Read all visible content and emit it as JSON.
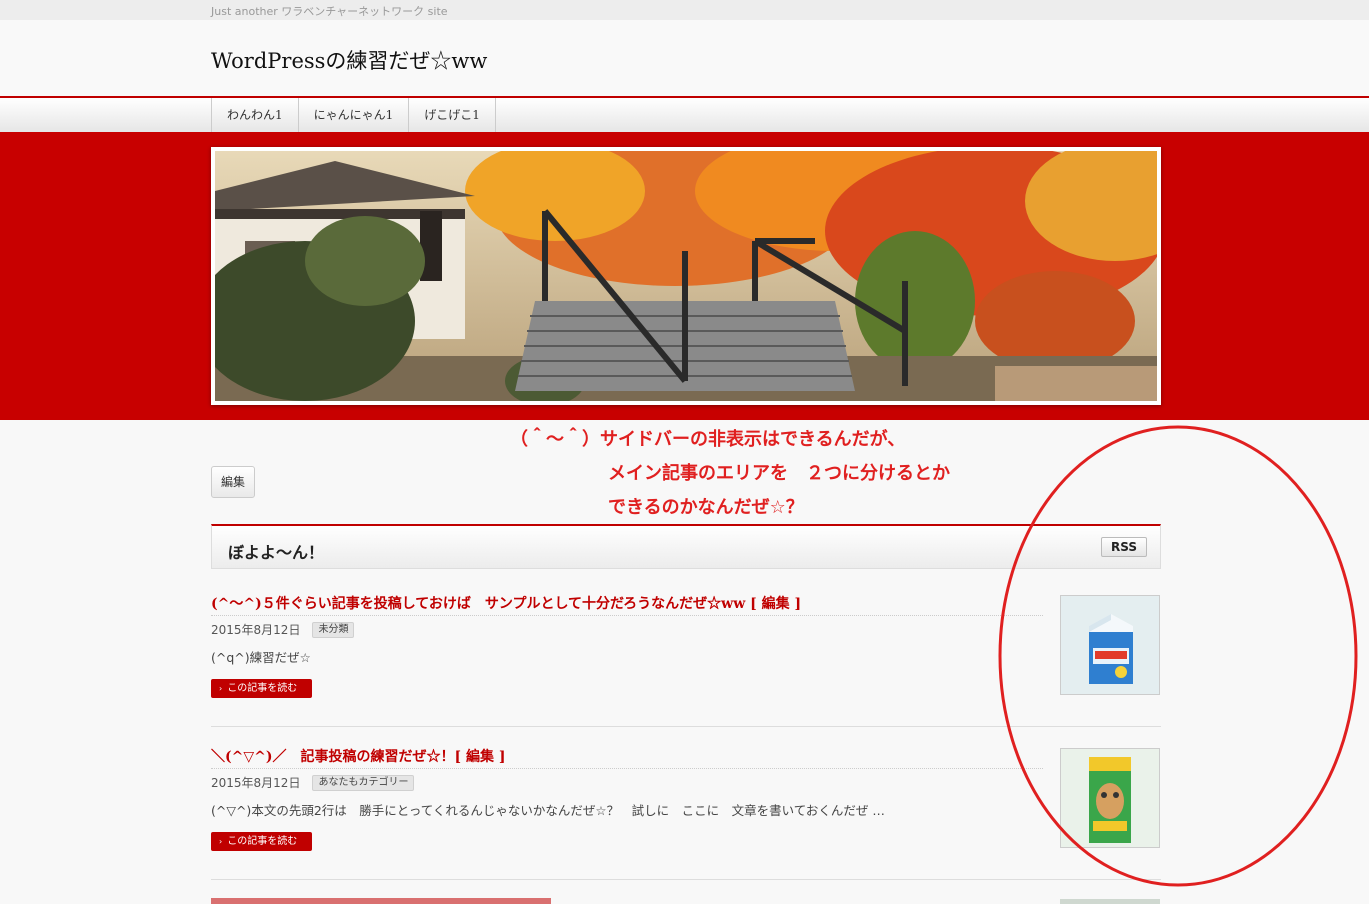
{
  "site": {
    "tagline": "Just another ワラベンチャーネットワーク site",
    "title": "WordPressの練習だぜ☆ww"
  },
  "nav": {
    "items": [
      {
        "label": "わんわん1"
      },
      {
        "label": "にゃんにゃん1"
      },
      {
        "label": "げこげこ1"
      }
    ]
  },
  "annotation": {
    "lines": [
      "（＾～＾）サイドバーの非表示はできるんだが、",
      "メイン記事のエリアを　２つに分けるとか",
      "できるのかなんだぜ☆？"
    ],
    "color": "#e02020"
  },
  "edit_button": "編集",
  "section": {
    "title": "ぼよよ～ん！",
    "rss_label": "RSS"
  },
  "posts": [
    {
      "title": "(^～^)５件ぐらい記事を投稿しておけば　サンプルとして十分だろうなんだぜ☆ww [ 編集 ]",
      "date": "2015年8月12日",
      "category": "未分類",
      "excerpt": "(^q^)練習だぜ☆",
      "read_more": "この記事を読む"
    },
    {
      "title": "＼(^▽^)／　記事投稿の練習だぜ☆！[ 編集 ]",
      "date": "2015年8月12日",
      "category": "あなたもカテゴリー",
      "excerpt": "(^▽^)本文の先頭2行は　勝手にとってくれるんじゃないかなんだぜ☆？　試しに　ここに　文章を書いておくんだぜ …",
      "read_more": "この記事を読む"
    }
  ],
  "colors": {
    "accent": "#c00000",
    "band": "#c80000"
  }
}
